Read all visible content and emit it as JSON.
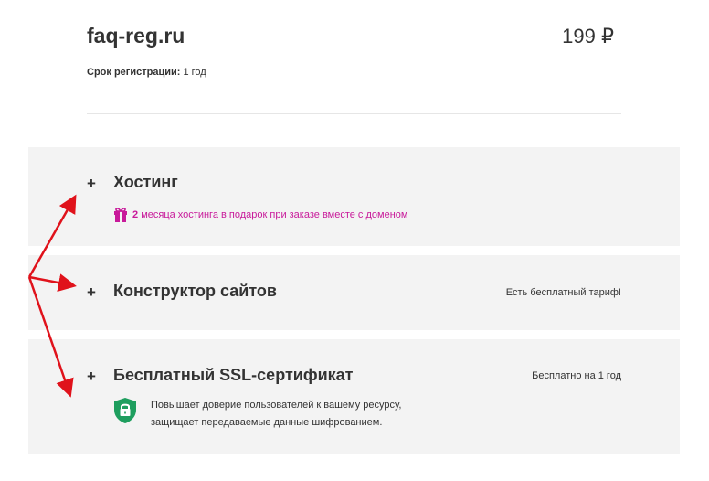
{
  "domain": {
    "name": "faq-reg.ru",
    "price": "199 ₽",
    "term_label": "Срок регистрации:",
    "term_value": "1 год"
  },
  "sections": {
    "hosting": {
      "toggle": "+",
      "title": "Хостинг",
      "promo_bold": "2",
      "promo_text": "месяца хостинга в подарок при заказе вместе с доменом",
      "promo_icon": "gift-icon"
    },
    "builder": {
      "toggle": "+",
      "title": "Конструктор сайтов",
      "note": "Есть бесплатный тариф!"
    },
    "ssl": {
      "toggle": "+",
      "title": "Бесплатный SSL-сертификат",
      "note": "Бесплатно на 1 год",
      "description_line1": "Повышает доверие пользователей к вашему ресурсу,",
      "description_line2": "защищает передаваемые данные шифрованием.",
      "icon": "shield-lock-icon"
    }
  },
  "colors": {
    "accent_pink": "#c8199a",
    "shield_green": "#1e9e5e",
    "arrow_red": "#e0121b",
    "panel_bg": "#f3f3f3"
  }
}
